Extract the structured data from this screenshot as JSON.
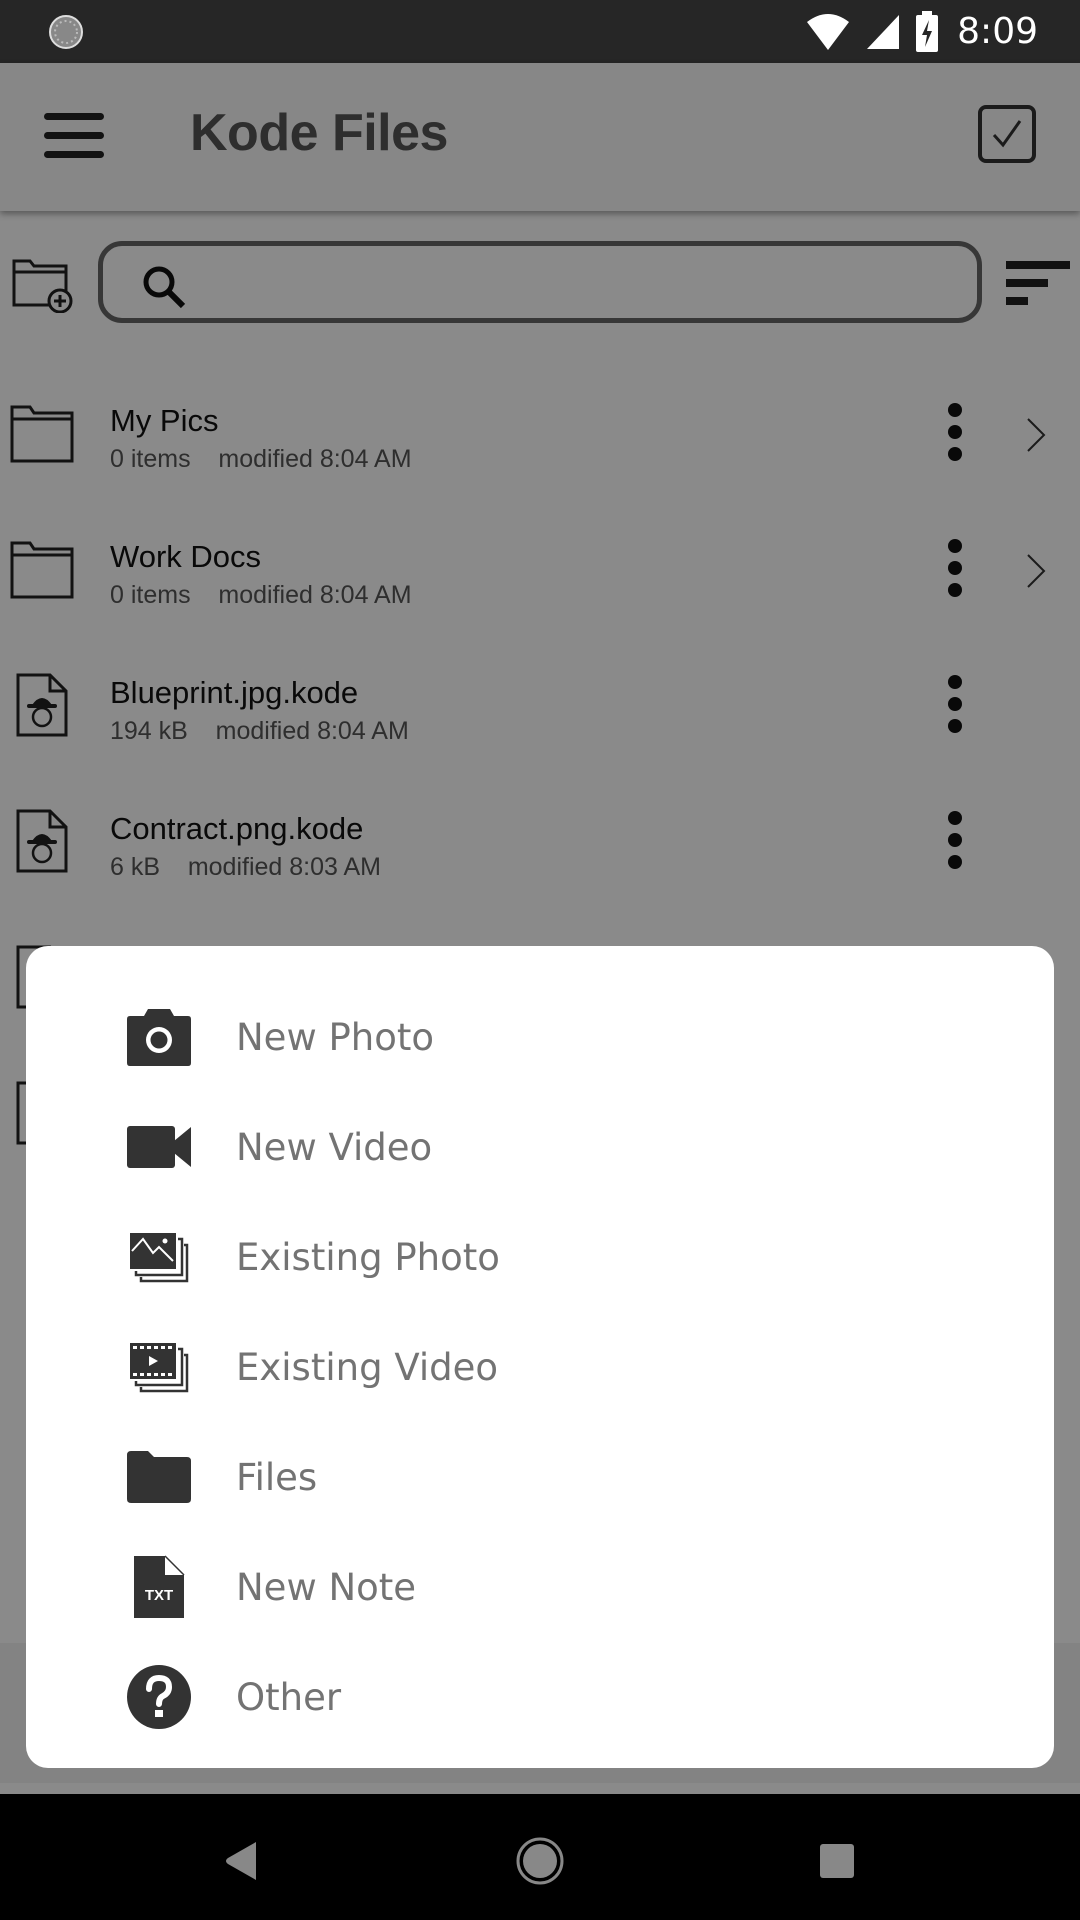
{
  "status_bar": {
    "time": "8:09",
    "icons": [
      "sync-spinner-icon",
      "wifi-icon",
      "cell-signal-icon",
      "battery-charging-icon"
    ]
  },
  "toolbar": {
    "title": "Kode Files",
    "menu_icon": "hamburger-menu-icon",
    "select_icon": "checkbox-select-icon"
  },
  "search": {
    "placeholder": "",
    "value": "",
    "new_folder_icon": "new-folder-icon",
    "sort_icon": "sort-icon"
  },
  "files": [
    {
      "name": "My Pics",
      "size": "0 items",
      "modified": "modified 8:04 AM",
      "type": "folder"
    },
    {
      "name": "Work Docs",
      "size": "0 items",
      "modified": "modified 8:04 AM",
      "type": "folder"
    },
    {
      "name": "Blueprint.jpg.kode",
      "size": "194 kB",
      "modified": "modified 8:04 AM",
      "type": "file"
    },
    {
      "name": "Contract.png.kode",
      "size": "6 kB",
      "modified": "modified 8:03 AM",
      "type": "file"
    }
  ],
  "sheet": {
    "items": [
      {
        "label": "New Photo",
        "icon": "camera-icon"
      },
      {
        "label": "New Video",
        "icon": "videocam-icon"
      },
      {
        "label": "Existing Photo",
        "icon": "photo-library-icon"
      },
      {
        "label": "Existing Video",
        "icon": "video-library-icon"
      },
      {
        "label": "Files",
        "icon": "folder-icon"
      },
      {
        "label": "New Note",
        "icon": "txt-file-icon",
        "icon_text": "TXT"
      },
      {
        "label": "Other",
        "icon": "help-icon"
      }
    ]
  },
  "nav_bar": {
    "back": "back-icon",
    "home": "home-icon",
    "recents": "recents-icon"
  },
  "colors": {
    "status_bar": "#262626",
    "sheet_text": "#737373",
    "icon_dark": "#333333"
  }
}
